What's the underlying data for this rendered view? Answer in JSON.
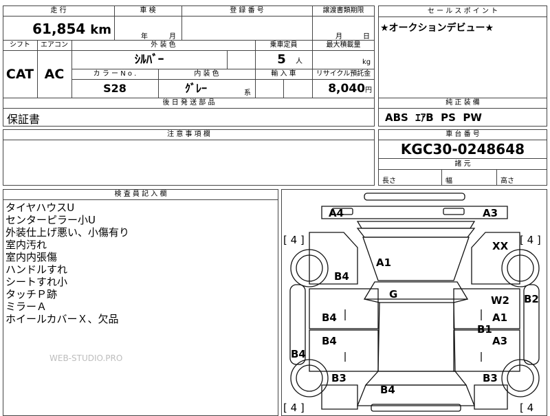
{
  "headers": {
    "mileage": "走 行",
    "inspection": "車 検",
    "registration": "登 録 番 号",
    "transfer_doc": "譲渡書類期限",
    "sales_point": "セ ー ル ス ポ イ ン ト",
    "shift": "シフト",
    "aircon": "エアコン",
    "exterior_color": "外 装 色",
    "capacity": "乗車定員",
    "max_load": "最大積載量",
    "color_no": "カ ラ ー N o .",
    "interior_color": "内 装 色",
    "import": "輸 入 車",
    "recycle": "リサイクル預託金",
    "later_parts": "後 日 発 送 部 品",
    "genuine_equipment": "純 正 装 備",
    "notes": "注 意 事 項 欄",
    "chassis": "車 台 番 号",
    "specs": "諸 元",
    "inspector": "検 査 員 記 入 欄"
  },
  "values": {
    "mileage": "61,854",
    "mileage_unit": "km",
    "year_unit": "年",
    "month_unit": "月",
    "transfer_month": "月",
    "transfer_day": "日",
    "sales_point": "★オークションデビュー★",
    "shift": "CAT",
    "aircon": "AC",
    "exterior_color": "ｼﾙﾊﾞｰ",
    "capacity": "5",
    "capacity_unit": "人",
    "max_load_unit": "kg",
    "color_no": "S28",
    "interior_color": "ｸﾞﾚｰ",
    "interior_suffix": "系",
    "recycle": "8,040",
    "recycle_unit": "円",
    "later_parts": "保証書",
    "genuine_equipment": "ABS  ｴｱB  PS  PW",
    "chassis": "KGC30-0248648",
    "length_label": "長さ",
    "width_label": "幅",
    "height_label": "高さ"
  },
  "inspector_notes": [
    "タイヤハウスU",
    "センターピラー小U",
    "外装仕上げ悪い、小傷有り",
    "室内汚れ",
    "室内内張傷",
    "ハンドルすれ",
    "シートすれ小",
    "タッチＰ跡",
    "ミラーＡ",
    "ホイールカバーＸ、欠品"
  ],
  "watermark": "WEB-STUDIO.PRO",
  "diagram": {
    "labels": {
      "a4": "A4",
      "a3_top": "A3",
      "xx": "XX",
      "a1_hood": "A1",
      "b4_front_left": "B4",
      "g_windshield": "G",
      "w2": "W2",
      "b2": "B2",
      "b4_door_front": "B4",
      "a1_door": "A1",
      "b1": "B1",
      "b4_door_rear": "B4",
      "a3_door": "A3",
      "b4_side": "B4",
      "b3_left": "B3",
      "b3_right": "B3",
      "b4_rear": "B4"
    },
    "tire_marks": [
      "[ 4 ]",
      "[ 4 ]",
      "[ 4 ]",
      "[ 4"
    ]
  }
}
